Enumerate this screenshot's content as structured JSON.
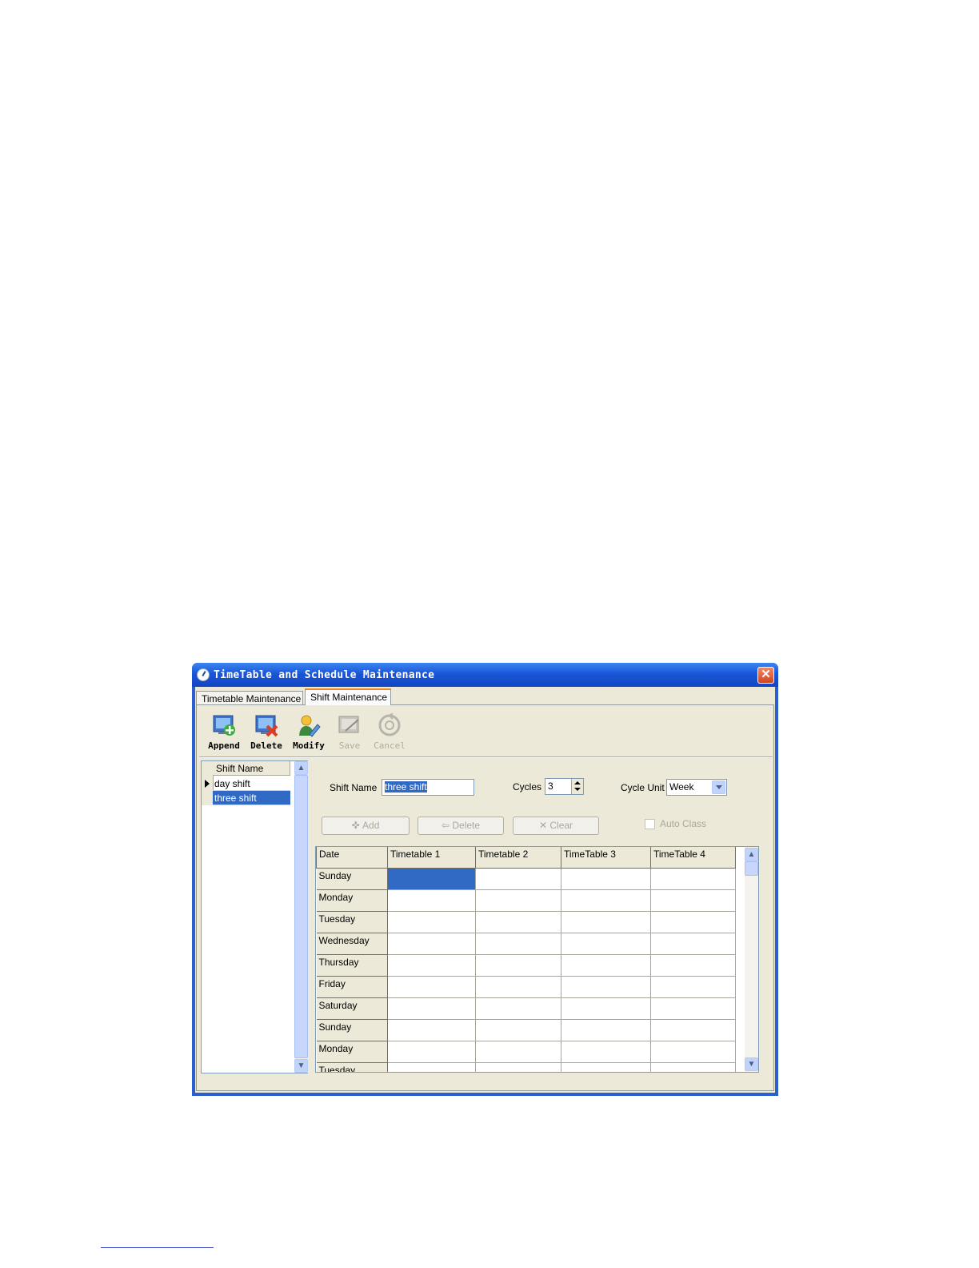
{
  "window": {
    "title": "TimeTable and Schedule Maintenance",
    "close_glyph": "✕"
  },
  "tabs": [
    {
      "label": "Timetable Maintenance"
    },
    {
      "label": "Shift Maintenance",
      "active": true
    }
  ],
  "toolbar": {
    "append": {
      "label": "Append",
      "icon": "append-icon"
    },
    "delete": {
      "label": "Delete",
      "icon": "delete-icon"
    },
    "modify": {
      "label": "Modify",
      "icon": "modify-icon"
    },
    "save": {
      "label": "Save",
      "icon": "save-icon",
      "enabled": false
    },
    "cancel": {
      "label": "Cancel",
      "icon": "cancel-icon",
      "enabled": false
    }
  },
  "shift_list": {
    "header": "Shift Name",
    "rows": [
      {
        "name": "day shift"
      },
      {
        "name": "three shift",
        "selected": true
      }
    ]
  },
  "form": {
    "shift_name_label": "Shift Name",
    "shift_name_value": "three shift",
    "cycles_label": "Cycles",
    "cycles_value": "3",
    "cycle_unit_label": "Cycle Unit",
    "cycle_unit_value": "Week"
  },
  "actions": {
    "add": "Add",
    "add_glyph": "✜",
    "delete": "Delete",
    "delete_glyph": "⇦",
    "clear": "Clear",
    "clear_glyph": "✕",
    "auto_class": "Auto Class"
  },
  "grid": {
    "columns": [
      "Date",
      "Timetable 1",
      "Timetable 2",
      "TimeTable 3",
      "TimeTable 4"
    ],
    "rows": [
      "Sunday",
      "Monday",
      "Tuesday",
      "Wednesday",
      "Thursday",
      "Friday",
      "Saturday",
      "Sunday",
      "Monday",
      "Tuesday"
    ]
  },
  "colors": {
    "title_bar": "#1a56d8",
    "selection": "#316ac5",
    "window_face": "#ece9d8",
    "tab_highlight": "#e68b2c"
  }
}
